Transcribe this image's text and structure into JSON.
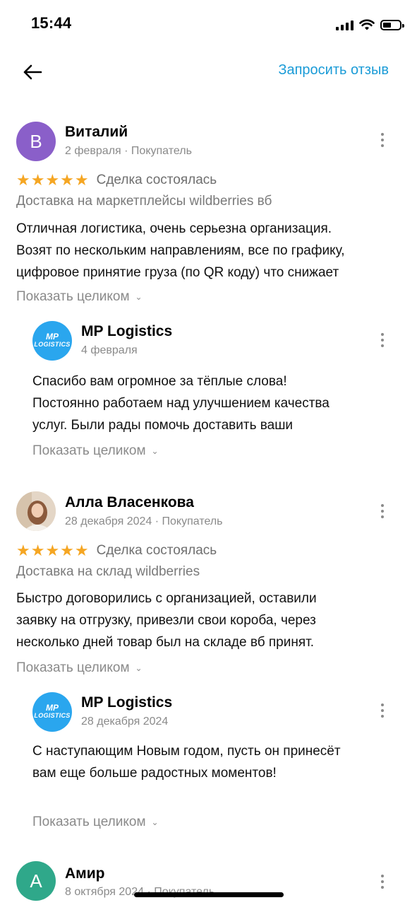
{
  "status_bar": {
    "time": "15:44"
  },
  "header": {
    "action_label": "Запросить отзыв"
  },
  "reviews": [
    {
      "avatar_letter": "В",
      "avatar_color": "#8a5fc9",
      "author": "Виталий",
      "meta": "2 февраля · Покупатель",
      "rating": 5,
      "stars": "★★★★★",
      "deal_status": "Сделка состоялась",
      "subject": "Доставка на маркетплейсы wildberries вб",
      "text_lines": [
        "Отличная логистика, очень серьезна организация.",
        "Возят по нескольким направлениям, все по графику,",
        "цифровое принятие груза (по QR коду) что снижает"
      ],
      "show_more": "Показать целиком",
      "reply": {
        "logo_text_1": "MP",
        "logo_text_2": "LOGISTICS",
        "author": "MP Logistics",
        "date": "4 февраля",
        "text_lines": [
          "Спасибо вам огромное за тёплые слова!",
          "Постоянно работаем над улучшением качества",
          "услуг. Были рады помочь доставить ваши"
        ],
        "show_more": "Показать целиком"
      }
    },
    {
      "avatar_photo": true,
      "author": "Алла Власенкова",
      "meta": "28 декабря 2024 · Покупатель",
      "rating": 5,
      "stars": "★★★★★",
      "deal_status": "Сделка состоялась",
      "subject": "Доставка на склад wildberries",
      "text_lines": [
        "Быстро договорились с организацией, оставили",
        "заявку на отгрузку, привезли свои короба, через",
        "несколько дней товар был на складе вб принят."
      ],
      "show_more": "Показать целиком",
      "reply": {
        "logo_text_1": "MP",
        "logo_text_2": "LOGISTICS",
        "author": "MP Logistics",
        "date": "28 декабря 2024",
        "text_lines": [
          "С наступающим Новым годом, пусть он принесёт",
          "вам еще больше радостных моментов!"
        ],
        "show_more": "Показать целиком"
      }
    },
    {
      "avatar_letter": "А",
      "avatar_color": "#2fa88a",
      "author": "Амир",
      "meta": "8 октября 2024 · Покупатель"
    }
  ]
}
